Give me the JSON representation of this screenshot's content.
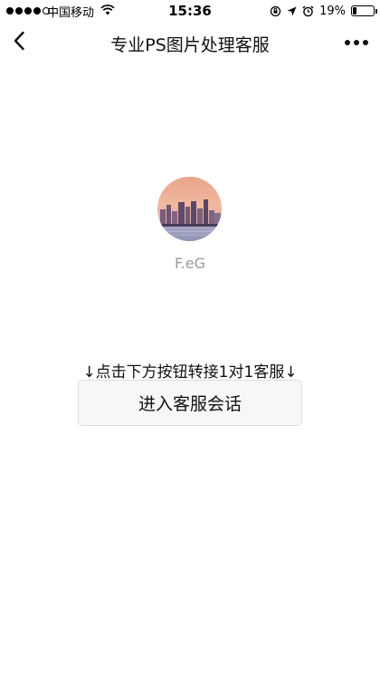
{
  "status_bar": {
    "carrier": "中国移动",
    "time": "15:36",
    "battery_text": "19%",
    "battery_level": 0.19,
    "signal_bars_filled": 4,
    "signal_bars_total": 5,
    "icons": [
      "wifi-icon",
      "rotation-lock-icon",
      "location-arrow-icon",
      "alarm-clock-icon",
      "battery-icon"
    ]
  },
  "nav": {
    "title": "专业PS图片处理客服",
    "back_icon": "chevron-left-icon",
    "more_icon": "more-dots-icon"
  },
  "profile": {
    "avatar": "city-skyline-avatar",
    "name": "F.eG"
  },
  "hint": "↓点击下方按钮转接1对1客服↓",
  "enter_button": {
    "label": "进入客服会话"
  }
}
